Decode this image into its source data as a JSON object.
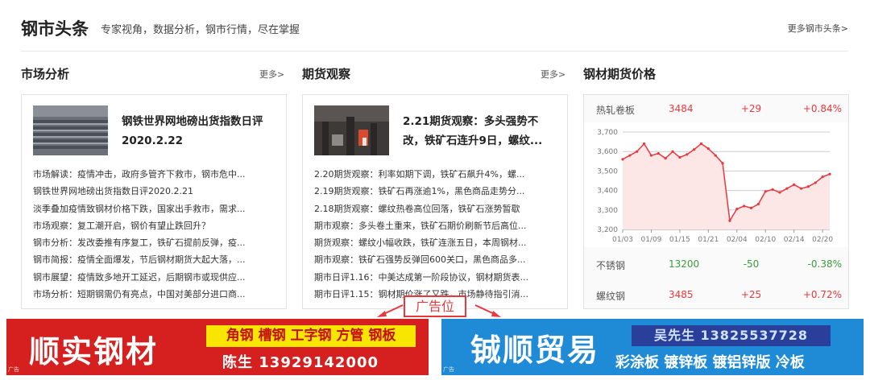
{
  "header": {
    "title": "钢市头条",
    "subtitle": "专家视角，数据分析，钢市行情，尽在掌握",
    "more": "更多钢市头条>"
  },
  "market": {
    "title": "市场分析",
    "more": "更多>",
    "feature_title": "钢铁世界网地磅出货指数日评2020.2.22",
    "items": [
      "市场解读：疫情冲击，政府多管齐下救市，钢市危中...",
      "钢铁世界网地磅出货指数日评2020.2.21",
      "淡季叠加疫情致钢材价格下跌，国家出手救市，需求...",
      "市场观察：复工潮开启，钢价有望止跌回升？",
      "钢市分析：发改委推有序复工，铁矿石提前反弹，疫...",
      "钢市简报：疫情全面爆发，节后钢材期货大起大落，...",
      "钢市展望：疫情致多地开工延迟，后期钢市或现供应...",
      "市场分析：短期钢需仍有亮点，中国对美部分进口商..."
    ]
  },
  "futures": {
    "title": "期货观察",
    "more": "更多>",
    "feature_title": "2.21期货观察：多头强势不改，铁矿石连升9日，螺纹...",
    "items": [
      "2.20期货观察：利率如期下调，铁矿石飙升4%，螺...",
      "2.19期货观察：铁矿石再涨逾1%，黑色商品走势分...",
      "2.18期货观察：螺纹热卷高位回落，铁矿石涨势暂歇",
      "期市观察：多头卷土重来，铁矿石期价刷新节后高位...",
      "期货观察：螺纹小幅收跌，铁矿连涨五日，本周钢材...",
      "期市观察：铁矿石强势反弹回600关口，黑色商品多...",
      "期市日评1.16：中美达成第一阶段协议，钢材期货表...",
      "期市日评1.15：钢材期价涨了又跌，市场静待指引消..."
    ]
  },
  "prices": {
    "title": "钢材期货价格",
    "rows": [
      {
        "name": "热轧卷板",
        "value": "3484",
        "change": "+29",
        "pct": "+0.84%",
        "dir": "up"
      },
      {
        "name": "不锈钢",
        "value": "13200",
        "change": "-50",
        "pct": "-0.38%",
        "dir": "down"
      },
      {
        "name": "螺纹钢",
        "value": "3485",
        "change": "+25",
        "pct": "+0.72%",
        "dir": "up"
      }
    ]
  },
  "chart_data": {
    "type": "area",
    "title": "",
    "xlabel": "",
    "ylabel": "",
    "ylim": [
      3200,
      3700
    ],
    "yticks": [
      "3,200",
      "3,300",
      "3,400",
      "3,500",
      "3,600",
      "3,700"
    ],
    "xticks": [
      "01/03",
      "01/09",
      "01/15",
      "01/21",
      "02/04",
      "02/10",
      "02/14",
      "02/20"
    ],
    "x": [
      "01/03",
      "01/06",
      "01/07",
      "01/08",
      "01/09",
      "01/10",
      "01/13",
      "01/14",
      "01/15",
      "01/16",
      "01/17",
      "01/20",
      "01/21",
      "01/22",
      "01/23",
      "02/03",
      "02/04",
      "02/05",
      "02/06",
      "02/07",
      "02/10",
      "02/11",
      "02/12",
      "02/13",
      "02/14",
      "02/17",
      "02/18",
      "02/19",
      "02/20",
      "02/21"
    ],
    "values": [
      3560,
      3580,
      3600,
      3640,
      3580,
      3590,
      3565,
      3600,
      3570,
      3585,
      3610,
      3640,
      3615,
      3580,
      3540,
      3245,
      3305,
      3320,
      3310,
      3330,
      3395,
      3405,
      3390,
      3410,
      3430,
      3410,
      3420,
      3440,
      3470,
      3484
    ],
    "color": "#e8383d",
    "fill": "#fde6e6",
    "grid": true
  },
  "ads": {
    "label": "广告位",
    "left": {
      "brand": "顺实钢材",
      "tag": "角钢 槽钢 工字钢 方管 钢板",
      "phone": "陈生 13929142000",
      "small": "广告"
    },
    "right": {
      "brand": "铖顺贸易",
      "tag": "吴先生 13825537728",
      "products": "彩涂板 镀锌板 镀铝锌版 冷板",
      "small": "广告"
    }
  }
}
